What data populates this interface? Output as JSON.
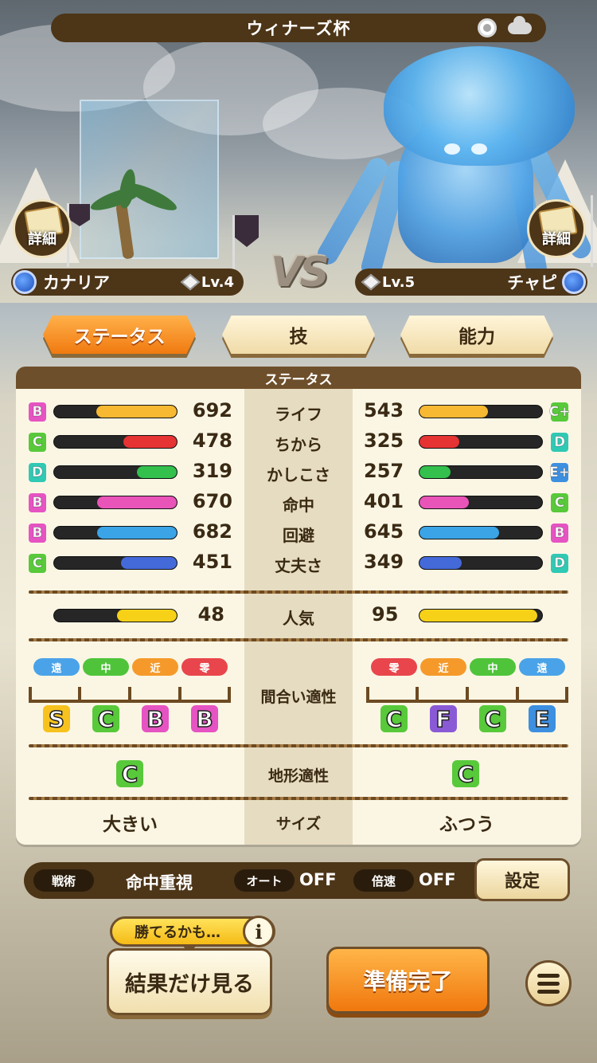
{
  "header": {
    "title": "ウィナーズ杯",
    "record_icon": "record-icon",
    "weather_icon": "cloud-icon"
  },
  "detail_label": "詳細",
  "players": {
    "left": {
      "name": "カナリア",
      "level": "Lv.4"
    },
    "right": {
      "name": "チャピ",
      "level": "Lv.5"
    }
  },
  "vs_text": "VS",
  "tabs": [
    "ステータス",
    "技",
    "能力"
  ],
  "panel": {
    "title": "ステータス",
    "stats": [
      {
        "label": "ライフ",
        "left_grade": "B",
        "left_value": "692",
        "left_fill": 0.65,
        "right_grade": "C+",
        "right_value": "543",
        "right_fill": 0.55,
        "color": "#f7b832"
      },
      {
        "label": "ちから",
        "left_grade": "C",
        "left_value": "478",
        "left_fill": 0.43,
        "right_grade": "D",
        "right_value": "325",
        "right_fill": 0.32,
        "color": "#e63333"
      },
      {
        "label": "かしこさ",
        "left_grade": "D",
        "left_value": "319",
        "left_fill": 0.32,
        "right_grade": "E+",
        "right_value": "257",
        "right_fill": 0.25,
        "color": "#33c04d"
      },
      {
        "label": "命中",
        "left_grade": "B",
        "left_value": "670",
        "left_fill": 0.64,
        "right_grade": "C",
        "right_value": "401",
        "right_fill": 0.4,
        "color": "#e954b8"
      },
      {
        "label": "回避",
        "left_grade": "B",
        "left_value": "682",
        "left_fill": 0.64,
        "right_grade": "B",
        "right_value": "645",
        "right_fill": 0.64,
        "color": "#3aa4e6"
      },
      {
        "label": "丈夫さ",
        "left_grade": "C",
        "left_value": "451",
        "left_fill": 0.45,
        "right_grade": "D",
        "right_value": "349",
        "right_fill": 0.34,
        "color": "#4469d9"
      }
    ],
    "popularity": {
      "label": "人気",
      "left_value": "48",
      "left_fill": 0.48,
      "right_value": "95",
      "right_fill": 0.95,
      "color": "#f7d118"
    },
    "range": {
      "label": "間合い適性",
      "left_chips": [
        "遠",
        "中",
        "近",
        "零"
      ],
      "left_grades": [
        "S",
        "C",
        "B",
        "B"
      ],
      "right_chips": [
        "零",
        "近",
        "中",
        "遠"
      ],
      "right_grades": [
        "C",
        "F",
        "C",
        "E"
      ]
    },
    "terrain": {
      "label": "地形適性",
      "left_grade": "C",
      "right_grade": "C"
    },
    "size": {
      "label": "サイズ",
      "left_value": "大きい",
      "right_value": "ふつう"
    }
  },
  "settings": {
    "tactics_label": "戦術",
    "tactics_value": "命中重視",
    "auto_label": "オート",
    "auto_value": "OFF",
    "speed_label": "倍速",
    "speed_value": "OFF",
    "settings_button": "設定"
  },
  "actions": {
    "hint": "勝てるかも…",
    "info_icon": "i",
    "result_button": "結果だけ見る",
    "ready_button": "準備完了",
    "menu_icon": "hamburger-icon"
  },
  "colors": {
    "grade_S": "#f7c21d",
    "grade_B": "#e653c2",
    "grade_C": "#58c93a",
    "grade_D": "#2fc9b4",
    "grade_E": "#3d8fe0",
    "grade_F": "#8a5ad6",
    "chip_far": "#4aa3e8",
    "chip_mid": "#4fc43a",
    "chip_near": "#f59a2a",
    "chip_zero": "#e8464c"
  }
}
